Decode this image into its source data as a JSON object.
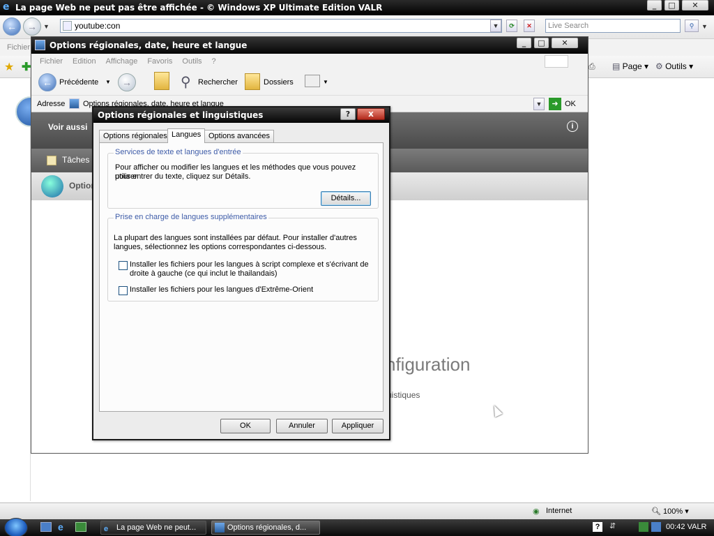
{
  "ie": {
    "title": "La page Web ne peut pas être affichée - © Windows XP Ultimate Edition VALR",
    "address": "youtube:con",
    "search_placeholder": "Live Search",
    "menu_first": "Fichier",
    "page_menu": "Page",
    "tools_menu": "Outils",
    "status_zone": "Internet",
    "zoom": "100%"
  },
  "cp": {
    "title": "Options régionales, date, heure et langue",
    "menu": [
      "Fichier",
      "Edition",
      "Affichage",
      "Favoris",
      "Outils",
      "?"
    ],
    "toolbar": {
      "back": "Précédente",
      "search": "Rechercher",
      "folders": "Dossiers"
    },
    "address_label": "Adresse",
    "address_value": "Options régionales, date, heure et langue",
    "go": "OK",
    "see_also": "Voir aussi",
    "tasks": "Tâches",
    "item": "Options",
    "bg_heading_fragment": "nfiguration",
    "bg_sub_fragment": "uistiques"
  },
  "dialog": {
    "title": "Options régionales et linguistiques",
    "help": "?",
    "close": "x",
    "tabs": [
      "Options régionales",
      "Langues",
      "Options avancées"
    ],
    "group1": {
      "legend": "Services de texte et langues d'entrée",
      "text_line1": "Pour afficher ou modifier les langues et les méthodes que vous pouvez utiliser",
      "text_line2": "pour entrer du texte, cliquez sur Détails.",
      "details_button": "Détails..."
    },
    "group2": {
      "legend": "Prise en charge de langues supplémentaires",
      "text_line1": "La plupart des langues sont installées par défaut. Pour installer d'autres",
      "text_line2": "langues, sélectionnez les options correspondantes ci-dessous.",
      "check1_line1": "Installer les fichiers pour les langues à script complexe et s'écrivant de",
      "check1_line2": "droite à gauche (ce qui inclut le thailandais)",
      "check2": "Installer les fichiers pour les langues d'Extrême-Orient",
      "check1_checked": false,
      "check2_checked": false
    },
    "ok": "OK",
    "cancel": "Annuler",
    "apply": "Appliquer"
  },
  "taskbar": {
    "items": [
      "La page Web ne peut...",
      "Options régionales, d..."
    ],
    "clock": "00:42 VALR"
  }
}
